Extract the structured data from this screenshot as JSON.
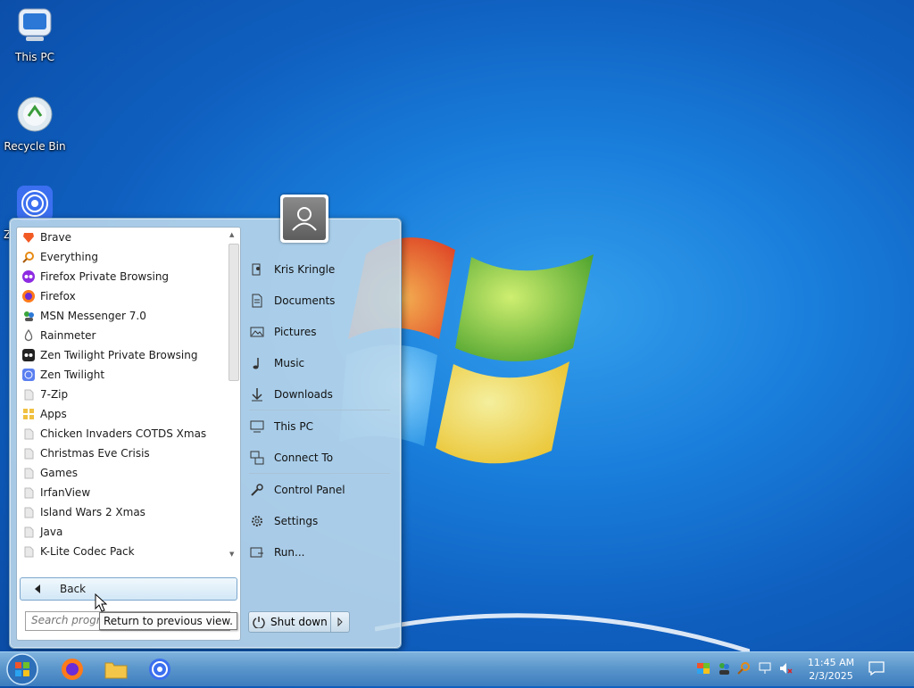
{
  "desktop": {
    "icons": [
      {
        "label": "This PC"
      },
      {
        "label": "Recycle Bin"
      },
      {
        "label": "Z"
      }
    ]
  },
  "start_menu": {
    "programs": [
      {
        "label": "Brave",
        "icon": "brave-icon"
      },
      {
        "label": "Everything",
        "icon": "magnifier-icon"
      },
      {
        "label": "Firefox Private Browsing",
        "icon": "firefox-private-icon"
      },
      {
        "label": "Firefox",
        "icon": "firefox-icon"
      },
      {
        "label": "MSN Messenger 7.0",
        "icon": "msn-icon"
      },
      {
        "label": "Rainmeter",
        "icon": "rainmeter-icon"
      },
      {
        "label": "Zen Twilight Private Browsing",
        "icon": "zen-private-icon"
      },
      {
        "label": "Zen Twilight",
        "icon": "zen-icon"
      },
      {
        "label": "7-Zip",
        "icon": "folder-icon"
      },
      {
        "label": "Apps",
        "icon": "apps-icon"
      },
      {
        "label": "Chicken Invaders COTDS Xmas",
        "icon": "folder-icon"
      },
      {
        "label": "Christmas Eve Crisis",
        "icon": "folder-icon"
      },
      {
        "label": "Games",
        "icon": "folder-icon"
      },
      {
        "label": "IrfanView",
        "icon": "folder-icon"
      },
      {
        "label": "Island Wars 2 Xmas",
        "icon": "folder-icon"
      },
      {
        "label": "Java",
        "icon": "folder-icon"
      },
      {
        "label": "K-Lite Codec Pack",
        "icon": "folder-icon"
      }
    ],
    "back_label": "Back",
    "search_placeholder": "Search programs and files",
    "tooltip": "Return to previous view.",
    "right_items": [
      {
        "label": "Kris Kringle"
      },
      {
        "label": "Documents"
      },
      {
        "label": "Pictures"
      },
      {
        "label": "Music"
      },
      {
        "label": "Downloads"
      },
      {
        "label": "This PC"
      },
      {
        "label": "Connect To"
      },
      {
        "label": "Control Panel"
      },
      {
        "label": "Settings"
      },
      {
        "label": "Run..."
      }
    ],
    "shutdown_label": "Shut down"
  },
  "taskbar": {
    "time": "11:45 AM",
    "date": "2/3/2025"
  },
  "colors": {
    "desktop_blue": "#1a7fdc",
    "menu_glass": "#bedaec",
    "taskbar": "#5c97cc"
  }
}
